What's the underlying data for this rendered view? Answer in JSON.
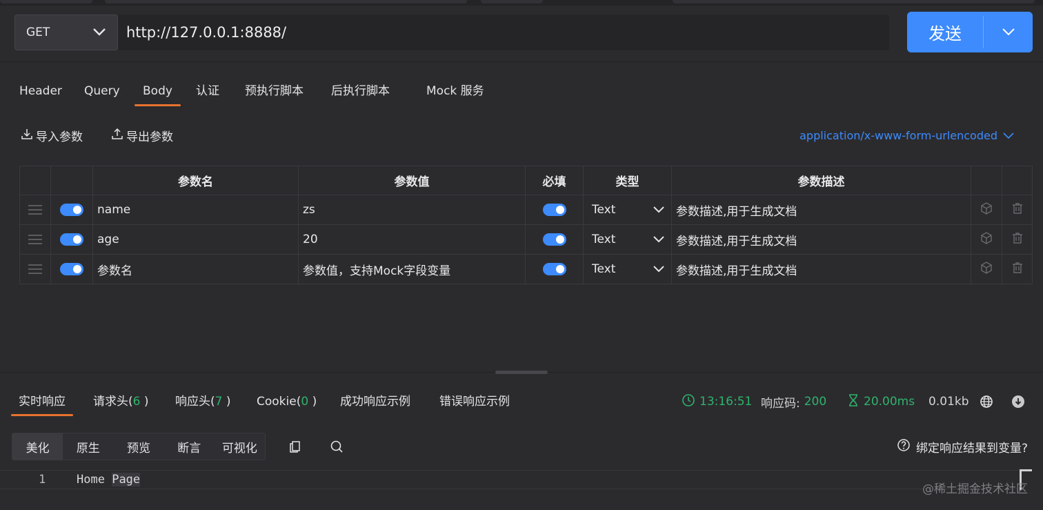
{
  "request": {
    "method": "GET",
    "url": "http://127.0.0.1:8888/",
    "send_label": "发送"
  },
  "request_tabs": [
    "Header",
    "Query",
    "Body",
    "认证",
    "预执行脚本",
    "后执行脚本",
    "Mock 服务"
  ],
  "active_request_tab": "Body",
  "toolbar": {
    "import_label": "导入参数",
    "export_label": "导出参数",
    "content_type": "application/x-www-form-urlencoded"
  },
  "params_table": {
    "headers": {
      "name": "参数名",
      "value": "参数值",
      "required": "必填",
      "type": "类型",
      "desc": "参数描述"
    },
    "rows": [
      {
        "name": "name",
        "value": "zs",
        "type": "Text",
        "desc_placeholder": "参数描述,用于生成文档"
      },
      {
        "name": "age",
        "value": "20",
        "type": "Text",
        "desc_placeholder": "参数描述,用于生成文档"
      }
    ],
    "new_row": {
      "name_placeholder": "参数名",
      "value_placeholder": "参数值，支持Mock字段变量",
      "type": "Text",
      "desc_placeholder": "参数描述,用于生成文档"
    }
  },
  "response": {
    "tabs": {
      "realtime": "实时响应",
      "req_headers": "请求头(",
      "req_headers_count": "6",
      "resp_headers": "响应头(",
      "resp_headers_count": "7",
      "cookie": "Cookie(",
      "cookie_count": "0",
      "close_paren": " )",
      "success_example": "成功响应示例",
      "error_example": "错误响应示例"
    },
    "time": "13:16:51",
    "code_label": "响应码:",
    "code": "200",
    "duration": "20.00ms",
    "size": "0.01kb",
    "view_tabs": [
      "美化",
      "原生",
      "预览",
      "断言",
      "可视化"
    ],
    "bind_label": "绑定响应结果到变量?",
    "line_number": "1",
    "body_word1": "Home",
    "body_word2": "Page"
  },
  "watermark": "@稀土掘金技术社区",
  "colors": {
    "accent": "#3d8bfd",
    "tab_underline": "#e8732f",
    "success": "#2fb36b",
    "background": "#2b2b2e"
  },
  "icons": [
    "chevron-down-icon",
    "download-icon",
    "upload-icon",
    "drag-handle-icon",
    "cube-icon",
    "trash-icon",
    "clock-icon",
    "hourglass-icon",
    "globe-icon",
    "download-circle-icon",
    "copy-icon",
    "search-icon",
    "help-circle-icon"
  ]
}
